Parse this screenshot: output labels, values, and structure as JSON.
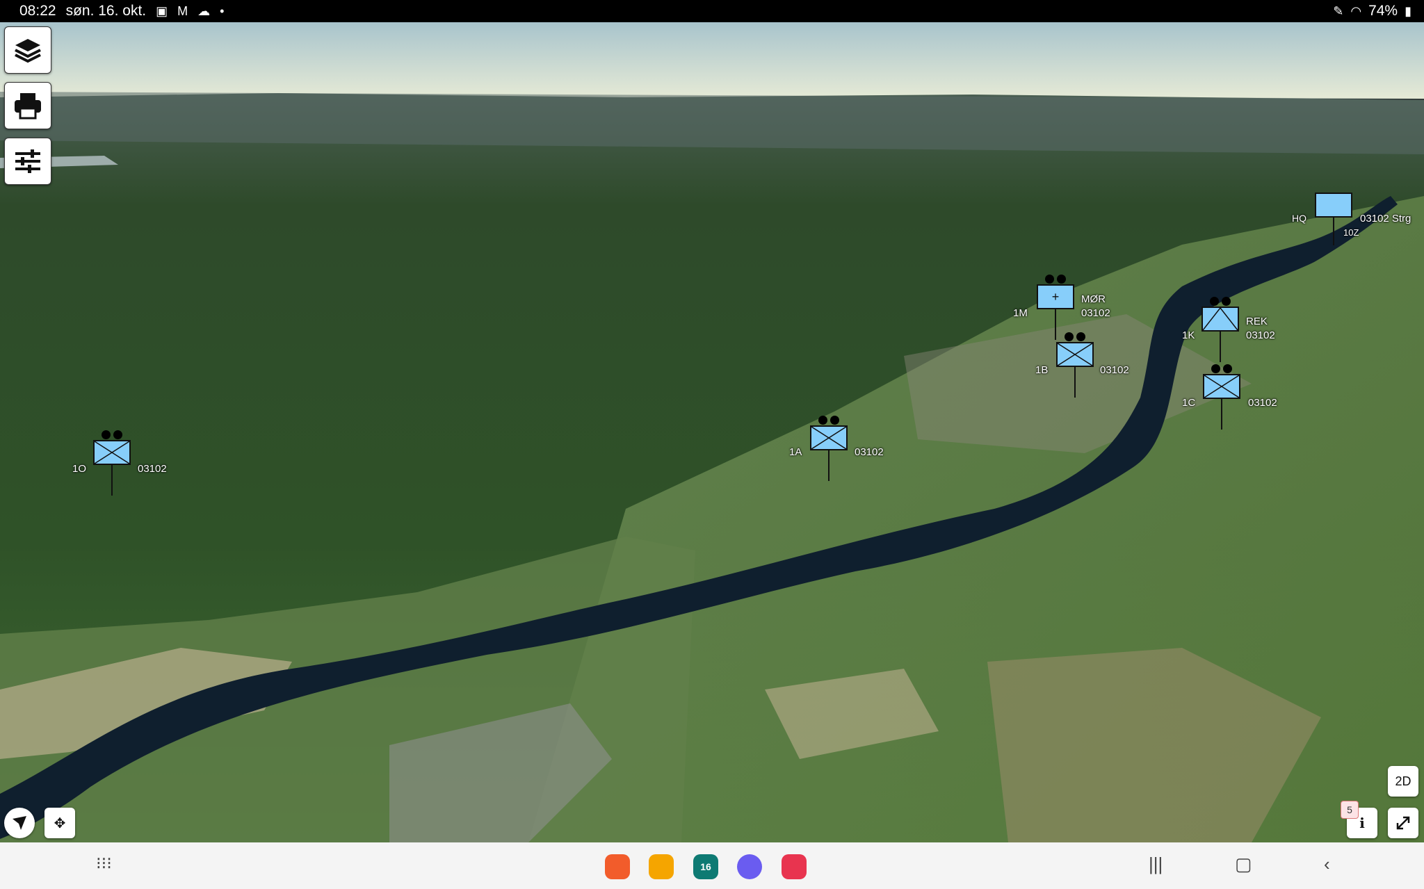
{
  "status_bar": {
    "time": "08:22",
    "date": "søn. 16. okt.",
    "battery": "74%",
    "icons": [
      "gallery-icon",
      "gmail-icon",
      "weather-icon",
      "dot-icon",
      "pen-icon",
      "wifi-icon",
      "battery-icon"
    ]
  },
  "toolbar": {
    "layers_icon": "layers-icon",
    "print_icon": "print-icon",
    "settings_icon": "sliders-icon"
  },
  "map_controls": {
    "view_mode": "2D",
    "badge_count": "5",
    "info_glyph": "i"
  },
  "units": [
    {
      "id": "1O",
      "code": "03102",
      "type": "infantry"
    },
    {
      "id": "1A",
      "code": "03102",
      "type": "infantry"
    },
    {
      "id": "1M",
      "name": "MØR",
      "code": "03102",
      "type": "medical"
    },
    {
      "id": "1B",
      "code": "03102",
      "type": "infantry"
    },
    {
      "id": "1K",
      "name": "REK",
      "code": "03102",
      "type": "recon"
    },
    {
      "id": "1C",
      "code": "03102",
      "type": "infantry"
    },
    {
      "id": "HQ",
      "name": "03102 Strg",
      "code": "10Z",
      "type": "hq"
    }
  ],
  "nav_bar": {
    "apps_icon": "apps-grid-icon",
    "recent_icon": "recent-apps-icon",
    "home_icon": "home-icon",
    "back_icon": "back-icon",
    "calendar_day": "16",
    "colors": {
      "app1": "#f25c2b",
      "app2": "#f5a500",
      "app3": "#0e7a73",
      "app4": "#6a5cf0",
      "app5": "#e8344f"
    }
  },
  "colors": {
    "unit_fill": "#87cefa",
    "river": "#0f1f2e"
  }
}
